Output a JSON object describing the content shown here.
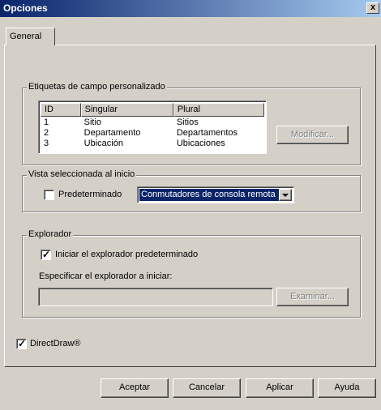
{
  "window": {
    "title": "Opciones",
    "close_label": "x"
  },
  "tabs": [
    {
      "label": "General"
    }
  ],
  "custom_fields": {
    "group_label": "Etiquetas de campo personalizado",
    "columns": [
      "ID",
      "Singular",
      "Plural"
    ],
    "rows": [
      [
        "1",
        "Sitio",
        "Sitios"
      ],
      [
        "2",
        "Departamento",
        "Departamentos"
      ],
      [
        "3",
        "Ubicación",
        "Ubicaciones"
      ]
    ],
    "modify_label": "Modificar...",
    "modify_mnemonic": "o"
  },
  "startup_view": {
    "group_label": "Vista seleccionada al inicio",
    "default_label": "Predeterminado",
    "default_checked": false,
    "select_value": "Conmutadores de consola remota"
  },
  "browser": {
    "group_label": "Explorador",
    "default_browser_label": "Iniciar el explorador predeterminado",
    "default_browser_checked": true,
    "specify_label": "Especificar el explorador a iniciar:",
    "path_value": "",
    "browse_label": "Examinar..."
  },
  "directdraw": {
    "label": "DirectDraw®",
    "checked": true
  },
  "buttons": {
    "ok": "Aceptar",
    "cancel": "Cancelar",
    "apply": "Aplicar",
    "help": "Ayuda"
  }
}
